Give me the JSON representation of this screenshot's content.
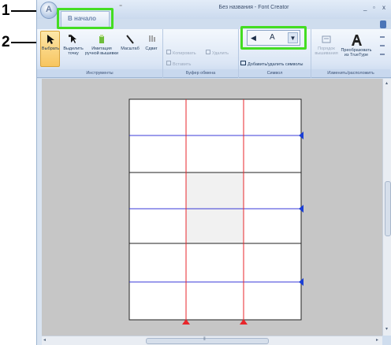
{
  "callouts": [
    {
      "number": "1"
    },
    {
      "number": "2"
    }
  ],
  "window": {
    "title": "Без названия - Font Creator",
    "minimize": "_",
    "restore": "▫",
    "close": "x"
  },
  "tabs": {
    "home": "В начало"
  },
  "ribbon": {
    "groups": {
      "tools": "Инструменты",
      "clipboard": "Буфер обмена",
      "symbol": "Символ",
      "change": "Изменить/расположить"
    },
    "buttons": {
      "select": "Выбрать",
      "select_point": "Выделить точку",
      "simulate": "Имитация ручной вышивки",
      "zoom": "Масштаб",
      "shift": "Сдвиг",
      "copy": "Копировать",
      "delete": "Удалить",
      "paste": "Вставить",
      "add_remove_symbols": "Добавить/удалить символы",
      "order": "Порядок вышивания",
      "convert": "Преобразовать из TrueType"
    }
  },
  "symbol_selector": {
    "prev_arrow": "◀",
    "current_letter": "A",
    "dropdown_arrow": "▼"
  },
  "colors": {
    "highlight": "#44dd22",
    "guide_red": "#e8262b",
    "guide_blue": "#3a3ad8",
    "marker_blue": "#1b3fd6"
  }
}
